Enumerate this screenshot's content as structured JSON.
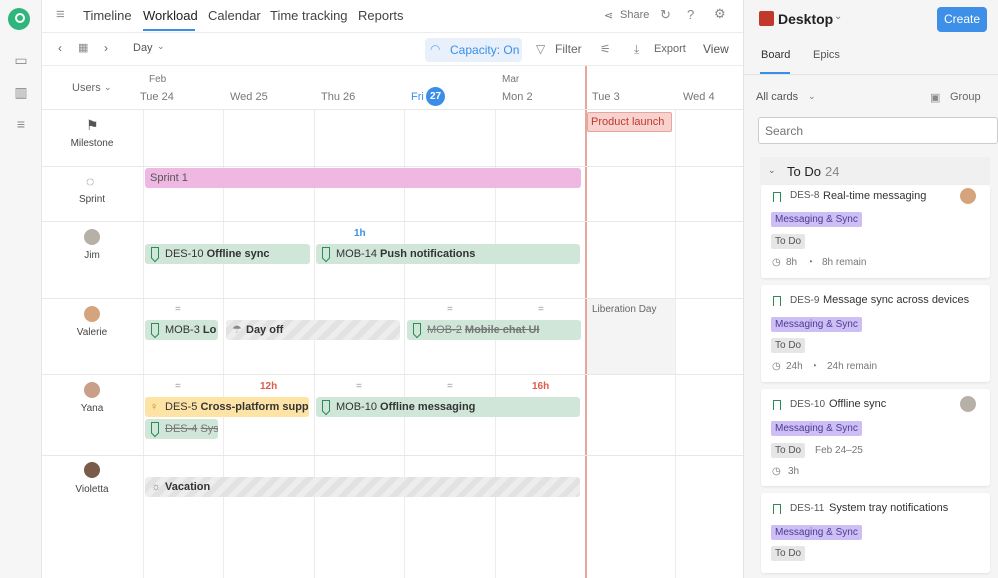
{
  "nav": {
    "tabs": [
      "Timeline",
      "Workload",
      "Calendar",
      "Time tracking",
      "Reports"
    ],
    "share": "Share"
  },
  "toolbar": {
    "zoom": "Day",
    "capacity": "Capacity: On",
    "filter": "Filter",
    "export": "Export",
    "view": "View"
  },
  "header": {
    "users_label": "Users",
    "months": [
      "Feb",
      "Mar"
    ],
    "days": [
      "Tue 24",
      "Wed 25",
      "Thu 26",
      "Fri",
      "Mon 2",
      "Tue 3",
      "Wed 4"
    ],
    "today": "27"
  },
  "rows": {
    "milestone": "Milestone",
    "sprint": "Sprint",
    "jim": "Jim",
    "valerie": "Valerie",
    "yana": "Yana",
    "violetta": "Violetta"
  },
  "bars": {
    "milestone": "Product launch",
    "sprint": "Sprint 1",
    "jim_cap": "1h",
    "jim_1_key": "DES-10",
    "jim_1_title": "Offline sync",
    "jim_2_key": "MOB-14",
    "jim_2_title": "Push notifications",
    "val_cap": [
      "=",
      "=",
      "="
    ],
    "val_1_key": "MOB-3",
    "val_1_title": "Lo",
    "val_dayoff": "Day off",
    "val_3_key": "MOB-2",
    "val_3_title": "Mobile chat UI",
    "holiday": "Liberation Day",
    "yana_cap": [
      "=",
      "12h",
      "=",
      "=",
      "16h"
    ],
    "yana_1_key": "DES-5",
    "yana_1_title": "Cross-platform suppo",
    "yana_2_key": "DES-4",
    "yana_2_title": "Sys",
    "yana_3_key": "MOB-10",
    "yana_3_title": "Offline messaging",
    "vio_vacation": "Vacation"
  },
  "panel": {
    "project": "Desktop",
    "create": "Create",
    "tabs": [
      "Board",
      "Epics"
    ],
    "filter": "All cards",
    "group": "Group",
    "search_placeholder": "Search",
    "column": {
      "title": "To Do",
      "count": "24"
    },
    "cards": [
      {
        "key": "DES-8",
        "title": "Real-time messaging",
        "tag": "Messaging & Sync",
        "status": "To Do",
        "est": "8h",
        "remain": "8h remain"
      },
      {
        "key": "DES-9",
        "title": "Message sync across devices",
        "tag": "Messaging & Sync",
        "status": "To Do",
        "est": "24h",
        "remain": "24h remain"
      },
      {
        "key": "DES-10",
        "title": "Offline sync",
        "tag": "Messaging & Sync",
        "status": "To Do",
        "dates": "Feb 24–25",
        "est": "3h"
      },
      {
        "key": "DES-11",
        "title": "System tray notifications",
        "tag": "Messaging & Sync",
        "status": "To Do"
      }
    ]
  },
  "colors": {
    "accent": "#3b8ee8",
    "task_green": "#cfe6d9",
    "milestone_red": "#f6c9c5",
    "sprint_pink": "#efb8e3",
    "tag_purple": "#cdbff5"
  }
}
